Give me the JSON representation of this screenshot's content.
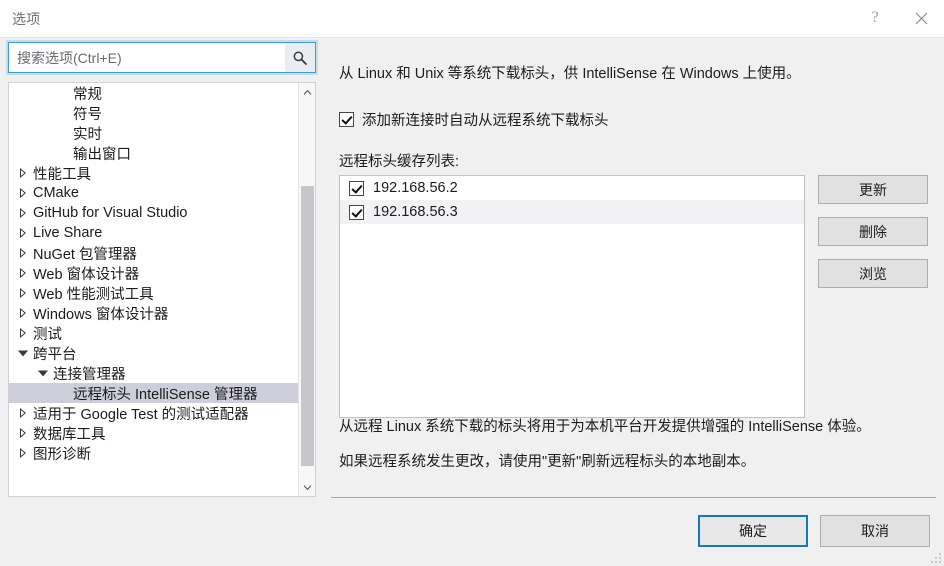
{
  "window": {
    "title": "选项",
    "help_icon": "question-mark-icon",
    "close_icon": "close-icon"
  },
  "search": {
    "placeholder": "搜索选项(Ctrl+E)",
    "value": "",
    "icon": "search-icon"
  },
  "tree": {
    "items": [
      {
        "label": "常规",
        "indent": 2,
        "expander": "none",
        "selected": false
      },
      {
        "label": "符号",
        "indent": 2,
        "expander": "none",
        "selected": false
      },
      {
        "label": "实时",
        "indent": 2,
        "expander": "none",
        "selected": false
      },
      {
        "label": "输出窗口",
        "indent": 2,
        "expander": "none",
        "selected": false
      },
      {
        "label": "性能工具",
        "indent": 0,
        "expander": "collapsed",
        "selected": false
      },
      {
        "label": "CMake",
        "indent": 0,
        "expander": "collapsed",
        "selected": false
      },
      {
        "label": "GitHub for Visual Studio",
        "indent": 0,
        "expander": "collapsed",
        "selected": false
      },
      {
        "label": "Live Share",
        "indent": 0,
        "expander": "collapsed",
        "selected": false
      },
      {
        "label": "NuGet 包管理器",
        "indent": 0,
        "expander": "collapsed",
        "selected": false
      },
      {
        "label": "Web 窗体设计器",
        "indent": 0,
        "expander": "collapsed",
        "selected": false
      },
      {
        "label": "Web 性能测试工具",
        "indent": 0,
        "expander": "collapsed",
        "selected": false
      },
      {
        "label": "Windows 窗体设计器",
        "indent": 0,
        "expander": "collapsed",
        "selected": false
      },
      {
        "label": "测试",
        "indent": 0,
        "expander": "collapsed",
        "selected": false
      },
      {
        "label": "跨平台",
        "indent": 0,
        "expander": "expanded",
        "selected": false
      },
      {
        "label": "连接管理器",
        "indent": 1,
        "expander": "expanded",
        "selected": false
      },
      {
        "label": "远程标头 IntelliSense 管理器",
        "indent": 2,
        "expander": "none",
        "selected": true
      },
      {
        "label": "适用于 Google Test 的测试适配器",
        "indent": 0,
        "expander": "collapsed",
        "selected": false
      },
      {
        "label": "数据库工具",
        "indent": 0,
        "expander": "collapsed",
        "selected": false
      },
      {
        "label": "图形诊断",
        "indent": 0,
        "expander": "collapsed",
        "selected": false
      }
    ],
    "scrollbar": {
      "up_icon": "chevron-up-icon",
      "down_icon": "chevron-down-icon"
    }
  },
  "panel": {
    "description": "从 Linux 和 Unix 等系统下载标头，供 IntelliSense 在 Windows 上使用。",
    "auto_download": {
      "label": "添加新连接时自动从远程系统下载标头",
      "checked": true
    },
    "cache_list_label": "远程标头缓存列表:",
    "cache_items": [
      {
        "ip": "192.168.56.2",
        "checked": true
      },
      {
        "ip": "192.168.56.3",
        "checked": true
      }
    ],
    "side_buttons": [
      {
        "label": "更新"
      },
      {
        "label": "删除"
      },
      {
        "label": "浏览"
      }
    ],
    "footnote_1": "从远程 Linux 系统下载的标头将用于为本机平台开发提供增强的 IntelliSense 体验。",
    "footnote_2": "如果远程系统发生更改，请使用\"更新\"刷新远程标头的本地副本。"
  },
  "footer": {
    "ok_label": "确定",
    "cancel_label": "取消"
  },
  "colors": {
    "accent": "#1679bd",
    "selection": "#cdced9",
    "dialog_bg": "#f0f0f0",
    "button_bg": "#e1e1e1"
  }
}
